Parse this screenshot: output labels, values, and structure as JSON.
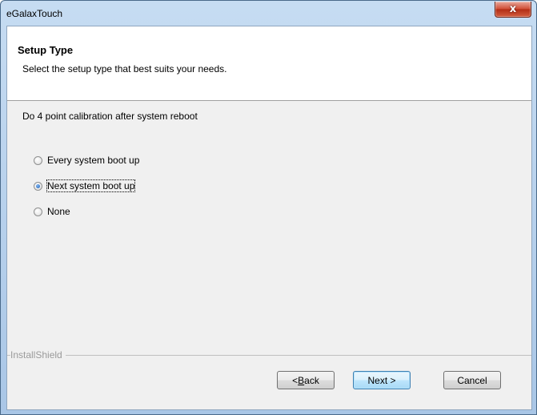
{
  "window": {
    "title": "eGalaxTouch",
    "close_label": "x"
  },
  "header": {
    "title": "Setup Type",
    "subtitle": "Select the setup type that best suits your needs."
  },
  "body": {
    "prompt": "Do 4 point calibration after system reboot",
    "options": [
      {
        "label": "Every system boot up",
        "selected": false
      },
      {
        "label": "Next system boot up",
        "selected": true
      },
      {
        "label": "None",
        "selected": false
      }
    ]
  },
  "footer": {
    "brand": "InstallShield",
    "back_prefix": "< ",
    "back_key": "B",
    "back_rest": "ack",
    "next_label": "Next >",
    "cancel_label": "Cancel"
  },
  "colors": {
    "client_bg": "#f0f0f0",
    "header_bg": "#ffffff",
    "frame": "#a9c6e6",
    "close": "#c8402a"
  }
}
